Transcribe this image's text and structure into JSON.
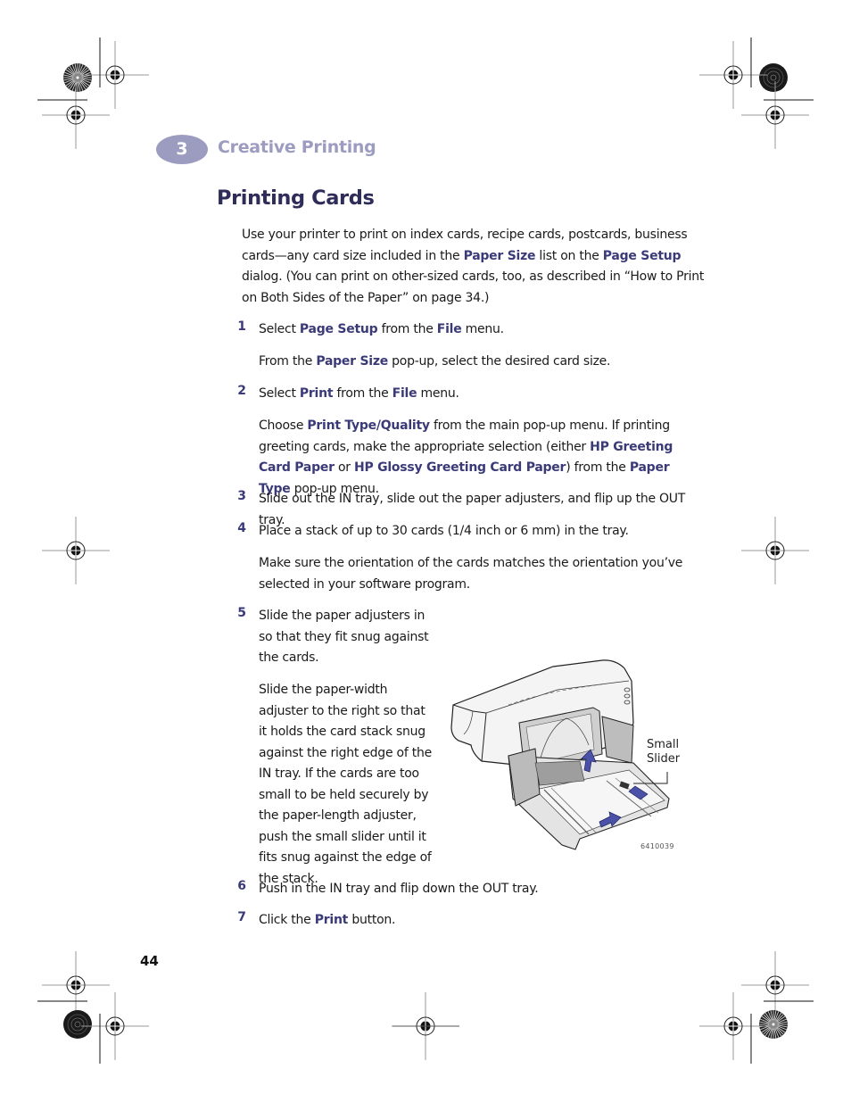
{
  "header": {
    "chapter_number": "3",
    "chapter_title": "Creative Printing"
  },
  "page_title": "Printing Cards",
  "intro": {
    "parts": [
      {
        "text": "Use your printer to print on index cards, recipe cards, postcards, business cards—any card size included in the ",
        "kw": false
      },
      {
        "text": "Paper Size",
        "kw": true
      },
      {
        "text": " list on the ",
        "kw": false
      },
      {
        "text": "Page Setup",
        "kw": true
      },
      {
        "text": " dialog. (You can print on other-sized cards, too, as described in “How to Print on Both Sides of the Paper” on page 34.)",
        "kw": false
      }
    ]
  },
  "steps": [
    {
      "number": "1",
      "parts": [
        {
          "text": "Select ",
          "kw": false
        },
        {
          "text": "Page Setup",
          "kw": true
        },
        {
          "text": " from the ",
          "kw": false
        },
        {
          "text": "File",
          "kw": true
        },
        {
          "text": " menu.",
          "kw": false
        }
      ],
      "note": [
        {
          "text": "From the ",
          "kw": false
        },
        {
          "text": "Paper Size",
          "kw": true
        },
        {
          "text": " pop-up, select the desired card size.",
          "kw": false
        }
      ]
    },
    {
      "number": "2",
      "parts": [
        {
          "text": "Select ",
          "kw": false
        },
        {
          "text": "Print",
          "kw": true
        },
        {
          "text": " from the ",
          "kw": false
        },
        {
          "text": "File",
          "kw": true
        },
        {
          "text": " menu.",
          "kw": false
        }
      ],
      "note": [
        {
          "text": "Choose ",
          "kw": false
        },
        {
          "text": "Print Type/Quality",
          "kw": true
        },
        {
          "text": " from the main pop-up menu. If printing greeting cards, make the appropriate selection (either ",
          "kw": false
        },
        {
          "text": "HP Greeting Card Paper",
          "kw": true
        },
        {
          "text": " or ",
          "kw": false
        },
        {
          "text": "HP Glossy Greeting Card Paper",
          "kw": true
        },
        {
          "text": ") from the ",
          "kw": false
        },
        {
          "text": "Paper Type",
          "kw": true
        },
        {
          "text": " pop-up menu.",
          "kw": false
        }
      ]
    },
    {
      "number": "3",
      "parts": [
        {
          "text": "Slide out the IN tray, slide out the paper adjusters, and flip up the OUT tray.",
          "kw": false
        }
      ]
    },
    {
      "number": "4",
      "parts": [
        {
          "text": "Place a stack of up to 30 cards (1/4 inch or 6 mm) in the tray.",
          "kw": false
        }
      ],
      "note": [
        {
          "text": "Make sure the orientation of the cards matches the orientation you’ve selected in your software program.",
          "kw": false
        }
      ]
    },
    {
      "number": "5",
      "parts": [
        {
          "text": "Slide the paper adjusters in so that they fit snug against the cards.",
          "kw": false
        }
      ],
      "note": [
        {
          "text": "Slide the paper-width adjuster to the right so that it holds the card stack snug against the right edge of the IN tray. If the cards are too small to be held securely by the paper-length adjuster, push the small slider until it fits snug against the edge of the stack.",
          "kw": false
        }
      ]
    },
    {
      "number": "6",
      "parts": [
        {
          "text": "Push in the IN tray and flip down the OUT tray.",
          "kw": false
        }
      ]
    },
    {
      "number": "7",
      "parts": [
        {
          "text": "Click the ",
          "kw": false
        },
        {
          "text": "Print",
          "kw": true
        },
        {
          "text": " button.",
          "kw": false
        }
      ]
    }
  ],
  "figure": {
    "callout_line1": "Small",
    "callout_line2": "Slider",
    "code": "6410039"
  },
  "page_number": "44",
  "colors": {
    "accent": "#3a3a78",
    "chapter": "#9c9cc0",
    "title": "#2e2d5a",
    "arrow": "#4a52a8"
  }
}
